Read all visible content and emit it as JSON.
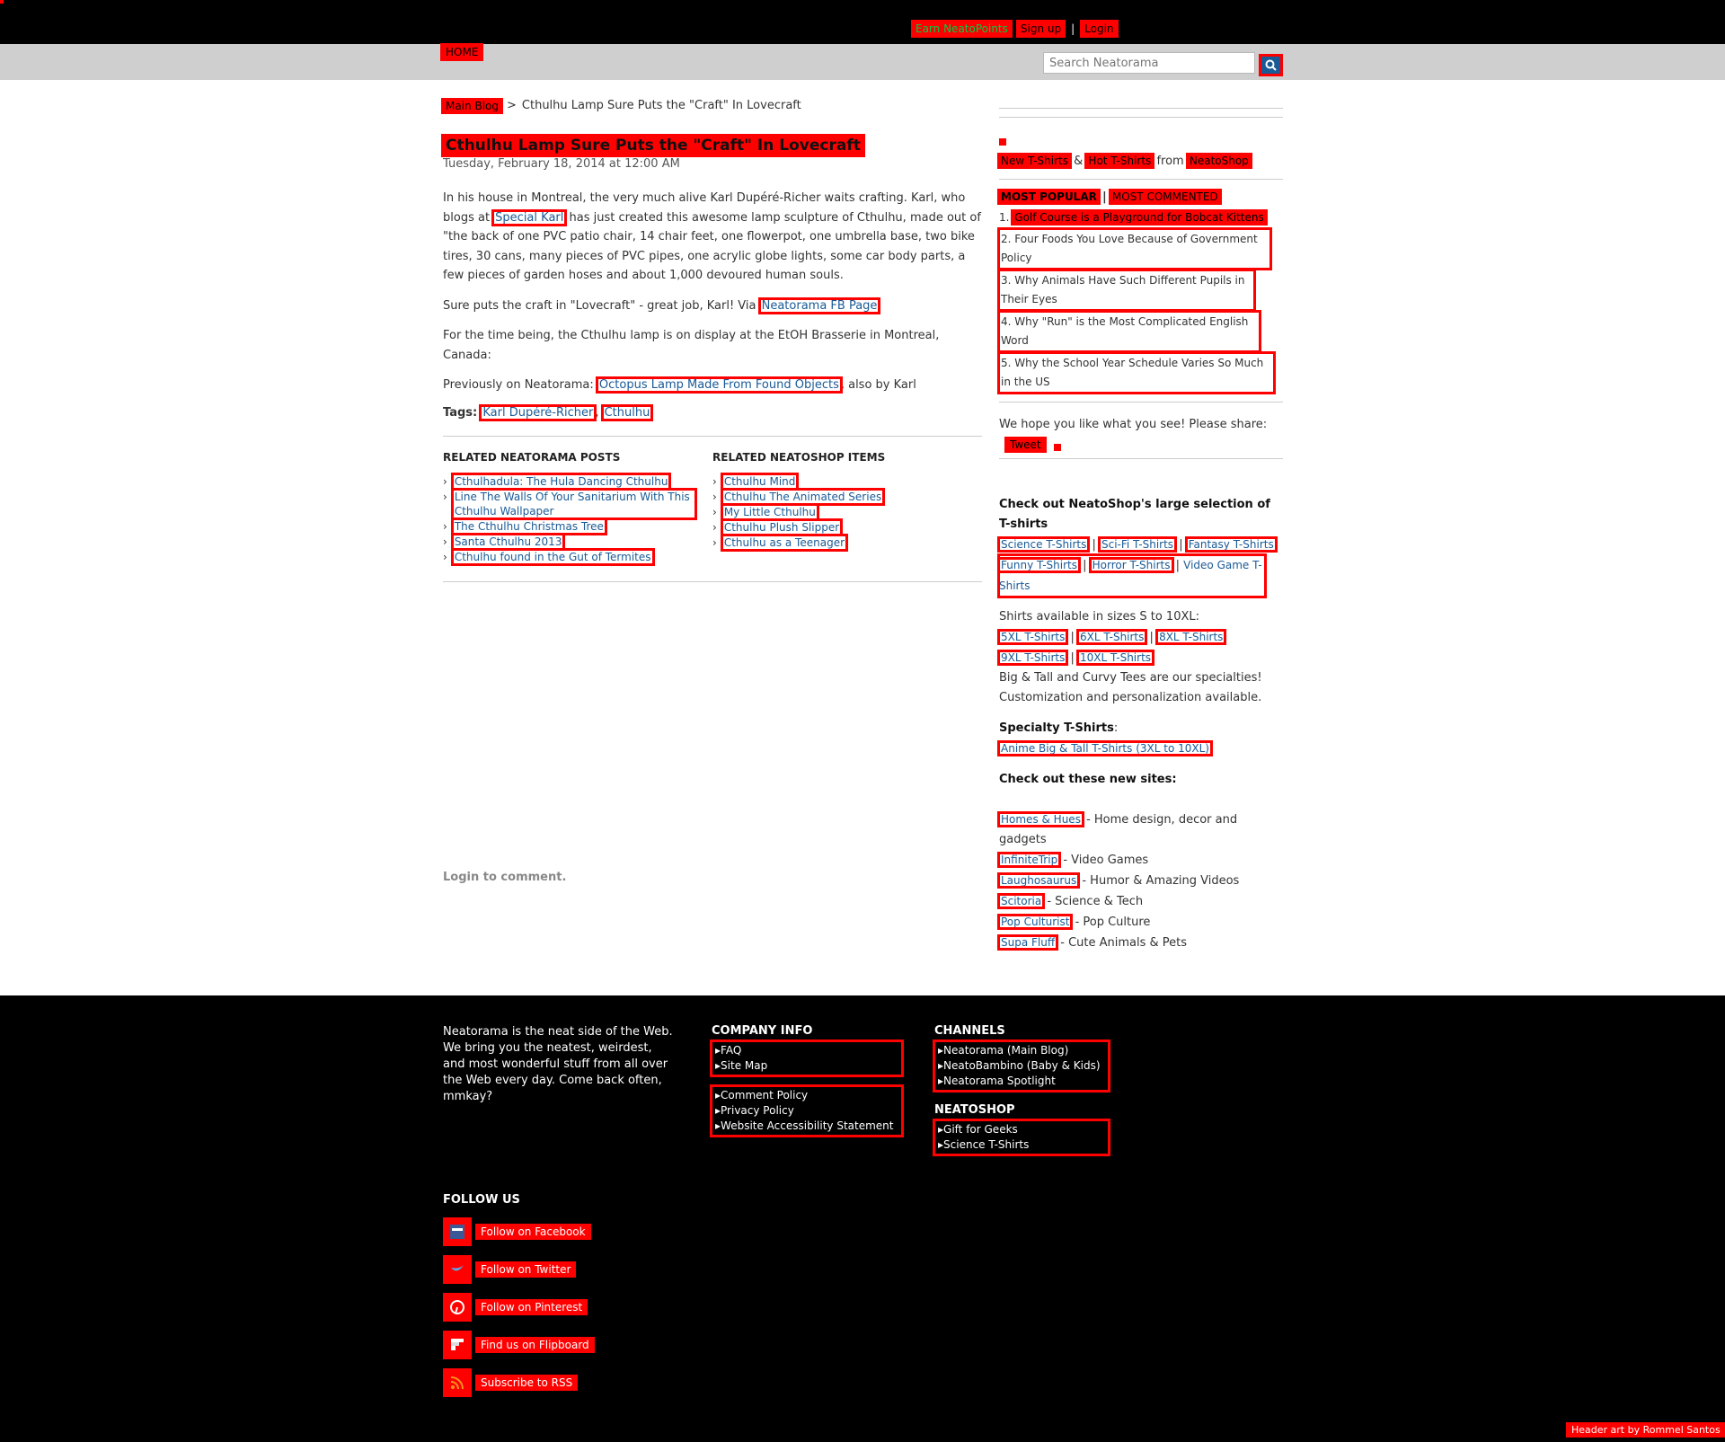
{
  "top": {
    "earn": "Earn NeatoPoints",
    "signup": "Sign up",
    "separator": "|",
    "login": "Login"
  },
  "nav": {
    "home": "HOME",
    "search_placeholder": "Search Neatorama"
  },
  "breadcrumb": {
    "parent": "Main Blog",
    "separator": ">",
    "current": "Cthulhu Lamp Sure Puts the \"Craft\" In Lovecraft"
  },
  "post": {
    "title": "Cthulhu Lamp Sure Puts the \"Craft\" In Lovecraft",
    "date": "Tuesday, February 18, 2014 at 12:00 AM",
    "p1_a": "In his house in Montreal, the very much alive Karl Dupéré-Richer waits crafting. Karl, who blogs at ",
    "p1_link": "Special Karl",
    "p1_b": " has just created this awesome lamp sculpture of Cthulhu, made out of \"the back of one PVC patio chair, 14 chair feet, one flowerpot, one umbrella base, two bike tires, 30 cans, many pieces of PVC pipes, one acrylic globe lights, some car body parts, a few pieces of garden hoses and about 1,000 devoured human souls.",
    "p2_a": "Sure puts the craft in \"Lovecraft\" - great job, Karl! Via ",
    "p2_link": "Neatorama FB Page",
    "p3": "For the time being, the Cthulhu lamp is on display at the EtOH Brasserie in Montreal, Canada:",
    "p4_a": "Previously on Neatorama: ",
    "p4_link": "Octopus Lamp Made From Found Objects",
    "p4_b": ", also by Karl",
    "tags_label": "Tags:",
    "tag1": "Karl Dupéré-Richer",
    "tag_sep": ", ",
    "tag2": "Cthulhu"
  },
  "related": {
    "posts_heading": "RELATED NEATORAMA POSTS",
    "posts": [
      "Cthulhadula: The Hula Dancing Cthulhu",
      "Line The Walls Of Your Sanitarium With This Cthulhu Wallpaper",
      "The Cthulhu Christmas Tree",
      "Santa Cthulhu 2013",
      "Cthulhu found in the Gut of Termites"
    ],
    "shop_heading": "RELATED NEATOSHOP ITEMS",
    "shop": [
      "Cthulhu Mind",
      "Cthulhu The Animated Series",
      "My Little Cthulhu",
      "Cthulhu Plush Slipper",
      "Cthulhu as a Teenager"
    ],
    "arrow": "›"
  },
  "login_comment": "Login to comment.",
  "sidebar": {
    "new_tshirts": "New T-Shirts",
    "amp": "&",
    "hot_tshirts": "Hot T-Shirts",
    "from": "from",
    "neatoshop": "NeatoShop",
    "tab_popular": "MOST POPULAR",
    "tab_sep": "|",
    "tab_commented": "MOST COMMENTED",
    "popular": [
      {
        "n": "1.",
        "t": "Golf Course is a Playground for Bobcat Kittens"
      },
      {
        "n": "2.",
        "t": "Four Foods You Love Because of Government Policy"
      },
      {
        "n": "3.",
        "t": "Why Animals Have Such Different Pupils in Their Eyes"
      },
      {
        "n": "4.",
        "t": "Why \"Run\" is the Most Complicated English Word"
      },
      {
        "n": "5.",
        "t": "Why the School Year Schedule Varies So Much in the US"
      }
    ],
    "share_text": "We hope you like what you see! Please share:",
    "tweet": "Tweet",
    "checkout_heading": "Check out NeatoShop's large selection of T-shirts",
    "shirt_links": [
      "Science T-Shirts",
      "Sci-Fi T-Shirts",
      "Fantasy T-Shirts",
      "Funny T-Shirts",
      "Horror T-Shirts",
      "Video Game T-Shirts"
    ],
    "sizes_text": "Shirts available in sizes S to 10XL:",
    "size_links": [
      "5XL T-Shirts",
      "6XL T-Shirts",
      "8XL T-Shirts",
      "9XL T-Shirts",
      "10XL T-Shirts"
    ],
    "specialties": "Big & Tall and Curvy Tees are our specialties! Customization and personalization available.",
    "specialty_label": "Specialty T-Shirts",
    "colon": ":",
    "specialty_link": "Anime Big & Tall T-Shirts (3XL to 10XL)",
    "new_sites_heading": "Check out these new sites:",
    "sites": [
      {
        "name": "Homes & Hues",
        "desc": " - Home design, decor and gadgets"
      },
      {
        "name": "InfiniteTrip",
        "desc": " - Video Games"
      },
      {
        "name": "Laughosaurus",
        "desc": " - Humor & Amazing Videos"
      },
      {
        "name": "Scitoria",
        "desc": " - Science & Tech"
      },
      {
        "name": "Pop Culturist",
        "desc": " - Pop Culture"
      },
      {
        "name": "Supa Fluff",
        "desc": " - Cute Animals & Pets"
      }
    ]
  },
  "footer": {
    "about": "Neatorama is the neat side of the Web. We bring you the neatest, weirdest, and most wonderful stuff from all over the Web every day. Come back often, mmkay?",
    "company_heading": "COMPANY INFO",
    "company_a": [
      "FAQ",
      "Site Map"
    ],
    "company_b": [
      "Comment Policy",
      "Privacy Policy",
      "Website Accessibility Statement"
    ],
    "channels_heading": "CHANNELS",
    "channels": [
      "Neatorama (Main Blog)",
      "NeatoBambino (Baby & Kids)",
      "Neatorama Spotlight"
    ],
    "neatoshop_heading": "NEATOSHOP",
    "neatoshop": [
      "Gift for Geeks",
      "Science T-Shirts"
    ],
    "follow_heading": "FOLLOW US",
    "follow": [
      "Follow on Facebook",
      "Follow on Twitter",
      "Follow on Pinterest",
      "Find us on Flipboard",
      "Subscribe to RSS"
    ],
    "credit": "Header art by Rommel Santos"
  }
}
